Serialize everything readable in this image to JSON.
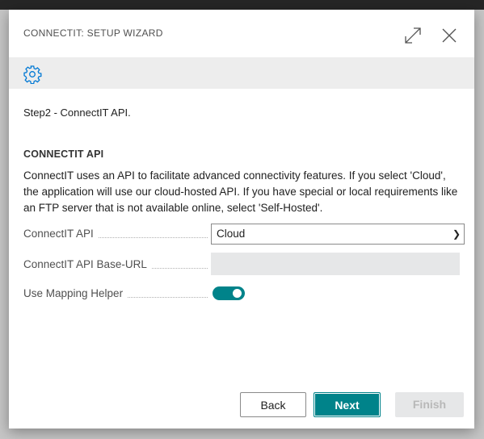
{
  "dialog": {
    "title": "CONNECTIT: SETUP WIZARD",
    "icons": {
      "expand": "expand-icon",
      "close": "close-icon",
      "settings": "gear-icon"
    },
    "step_text": "Step2 - ConnectIT API.",
    "section_title": "CONNECTIT API",
    "description": "ConnectIT uses an API to facilitate advanced connectivity features. If you select 'Cloud', the application will use our cloud-hosted API. If you have special or local requirements like an FTP server that is not available online, select 'Self-Hosted'.",
    "fields": [
      {
        "label": "ConnectIT API",
        "value": "Cloud"
      },
      {
        "label": "ConnectIT API Base-URL",
        "value": ""
      },
      {
        "label": "Use Mapping Helper",
        "value": true
      }
    ],
    "buttons": {
      "back": "Back",
      "next": "Next",
      "finish": "Finish"
    },
    "colors": {
      "accent": "#00838a",
      "gear": "#0078d4",
      "action_bar": "#ededed"
    }
  }
}
